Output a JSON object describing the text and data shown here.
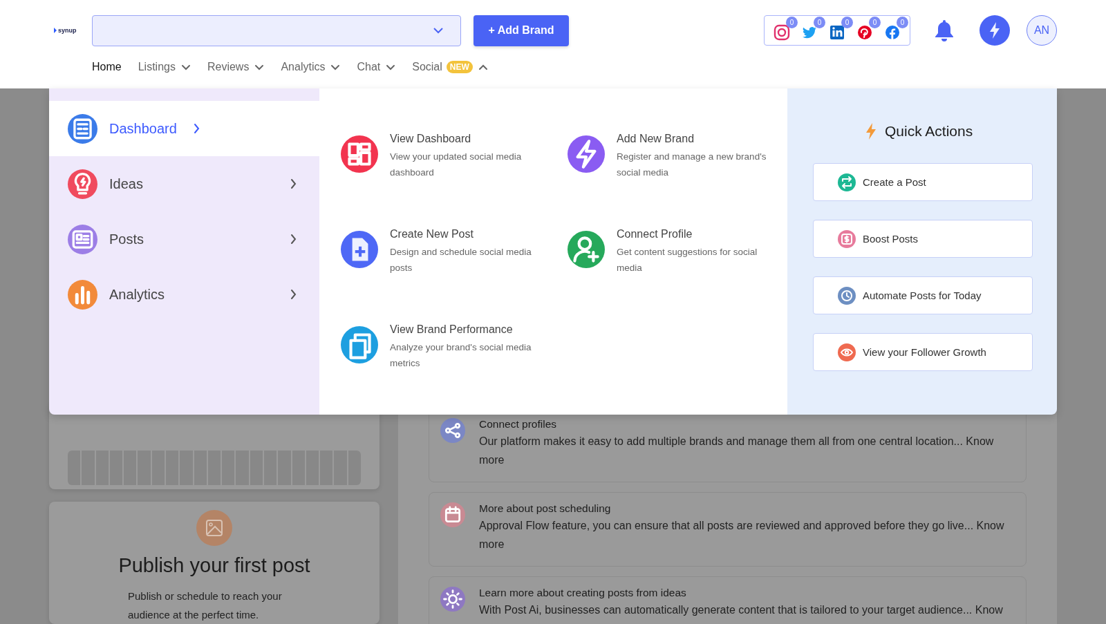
{
  "header": {
    "logo": "synup",
    "add_button": "+ Add Brand",
    "social_accounts": [
      {
        "kind": "instagram",
        "badge": "0"
      },
      {
        "kind": "twitter",
        "badge": "0"
      },
      {
        "kind": "linkedin",
        "badge": "0"
      },
      {
        "kind": "pinterest",
        "badge": "0"
      },
      {
        "kind": "facebook",
        "badge": "0"
      }
    ],
    "avatar": "AN"
  },
  "nav": [
    {
      "label": "Home",
      "selected": true
    },
    {
      "label": "Listings",
      "selected": false,
      "expanded": false
    },
    {
      "label": "Reviews",
      "selected": false,
      "expanded": false
    },
    {
      "label": "Analytics",
      "selected": false,
      "expanded": false
    },
    {
      "label": "Chat",
      "selected": false,
      "expanded": false
    },
    {
      "label": "Social",
      "selected": false,
      "expanded": true,
      "badge": "NEW"
    }
  ],
  "menu": {
    "sections": [
      {
        "label": "Dashboard",
        "kind": "dashboard",
        "color": "#3b7be9",
        "selected": true
      },
      {
        "label": "Ideas",
        "kind": "bulb",
        "color": "#f04b5e",
        "selected": false
      },
      {
        "label": "Posts",
        "kind": "posts",
        "color": "#9c7ee6",
        "selected": false
      },
      {
        "label": "Analytics",
        "kind": "chart",
        "color": "#f28a3a",
        "selected": false
      }
    ],
    "links": [
      {
        "title": "View Dashboard",
        "description": "View your updated social media dashboard",
        "kind": "grid",
        "color": "#f2344f"
      },
      {
        "title": "Add New Brand",
        "description": "Register and manage a new brand's social media",
        "kind": "bolt",
        "color": "#8a5cf2"
      },
      {
        "title": "Create New Post",
        "description": "Design and schedule social media posts",
        "kind": "file-plus",
        "color": "#4e68f6"
      },
      {
        "title": "Connect Profile",
        "description": "Get content suggestions for social media",
        "kind": "user-plus",
        "color": "#26a95b"
      },
      {
        "title": "View Brand Performance",
        "description": "Analyze your brand's social media metrics",
        "kind": "copy",
        "color": "#1d9fe0"
      }
    ],
    "quick_actions": {
      "title": "Quick Actions",
      "items": [
        {
          "label": "Create a Post",
          "kind": "repeat",
          "color": "#1db894"
        },
        {
          "label": "Boost Posts",
          "kind": "dollar",
          "color": "#e77b9c"
        },
        {
          "label": "Automate Posts for Today",
          "kind": "clock",
          "color": "#6d8fc2"
        },
        {
          "label": "View your Follower Growth",
          "kind": "eye",
          "color": "#ef6a50"
        }
      ]
    }
  },
  "publish_card": {
    "title": "Publish your first post",
    "description": "Publish or schedule to reach your audience at the perfect time."
  },
  "tips": [
    {
      "title": "Connect profiles",
      "description": "Our platform makes it easy to add multiple brands and manage them all from one central location... Know more",
      "kind": "share",
      "color": "#7b87c5"
    },
    {
      "title": "More about post scheduling",
      "description": "Approval Flow feature, you can ensure that all posts are reviewed and approved before they go live... Know more",
      "kind": "calendar",
      "color": "#c98a93"
    },
    {
      "title": "Learn more about creating posts from ideas",
      "description": "With Post Ai, businesses can automatically generate content that is tailored to your target audience... Know",
      "kind": "sun",
      "color": "#8e78c2"
    }
  ]
}
